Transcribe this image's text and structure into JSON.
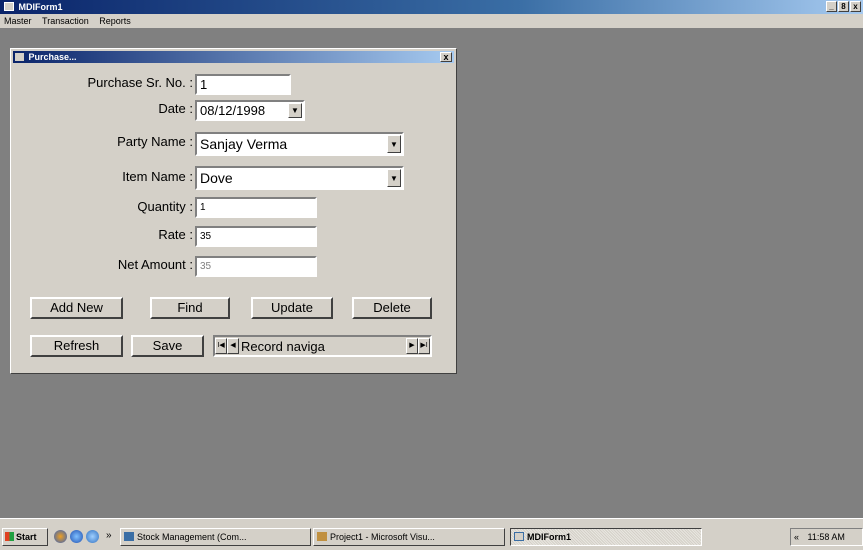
{
  "window": {
    "title": "MDIForm1",
    "controls": {
      "minimize": "_",
      "maximize": "8",
      "close": "x"
    }
  },
  "menu": [
    "Master",
    "Transaction",
    "Reports"
  ],
  "child": {
    "title": "Purchase...",
    "close": "x",
    "fields": {
      "purchase_sr_no": {
        "label": "Purchase Sr. No. :",
        "value": "1"
      },
      "date": {
        "label": "Date :",
        "value": "08/12/1998"
      },
      "party_name": {
        "label": "Party Name :",
        "value": "Sanjay Verma"
      },
      "item_name": {
        "label": "Item Name :",
        "value": "Dove"
      },
      "quantity": {
        "label": "Quantity :",
        "value": "1"
      },
      "rate": {
        "label": "Rate :",
        "value": "35"
      },
      "net_amount": {
        "label": "Net Amount :",
        "value": "35"
      }
    },
    "buttons": {
      "add_new": "Add New",
      "find": "Find",
      "update": "Update",
      "delete": "Delete",
      "refresh": "Refresh",
      "save": "Save"
    },
    "navigator": {
      "first": "I◀",
      "prev": "◀",
      "label": "Record naviga",
      "next": "▶",
      "last": "▶I"
    }
  },
  "taskbar": {
    "start": "Start",
    "chevron": "»",
    "tasks": [
      "Stock Management (Com...",
      "Project1 - Microsoft Visu...",
      "MDIForm1"
    ],
    "tray_chevron": "«",
    "clock": "11:58 AM"
  }
}
